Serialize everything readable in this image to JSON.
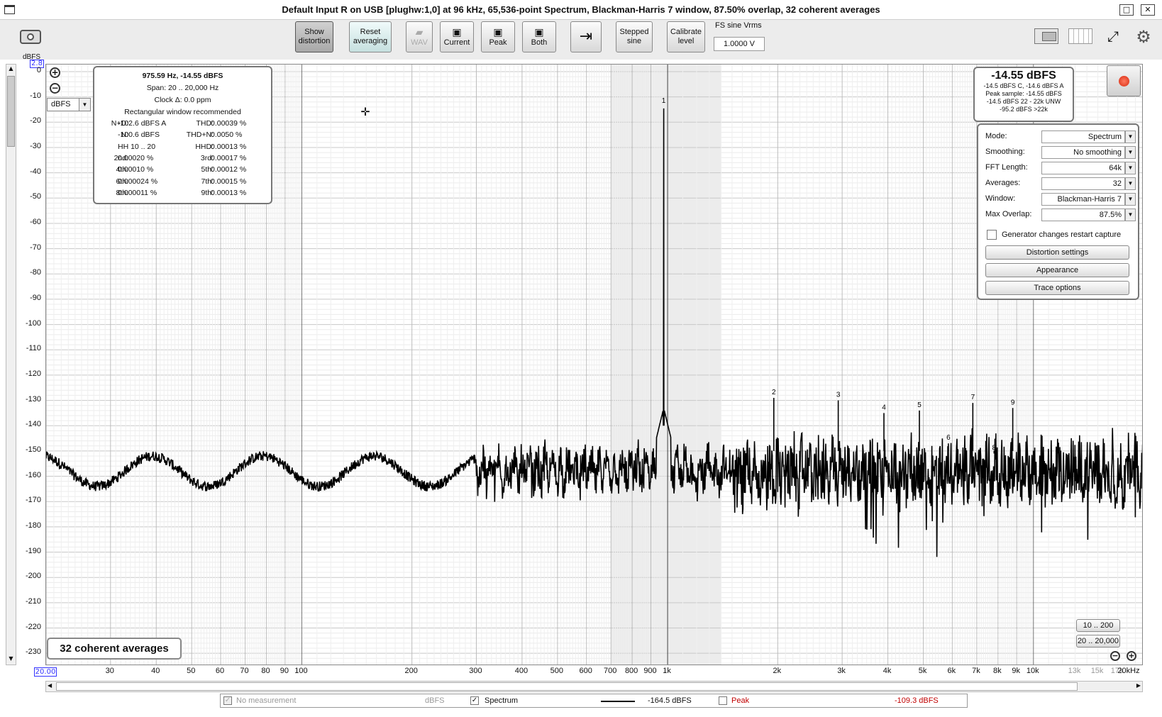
{
  "window": {
    "title": "Default Input R on USB [plughw:1,0] at 96 kHz, 65,536-point Spectrum, Blackman-Harris 7 window, 87.50% overlap, 32 coherent averages",
    "maximize_glyph": "□",
    "close_glyph": "✕"
  },
  "toolbar": {
    "show_distortion": [
      "Show",
      "distortion"
    ],
    "reset_averaging": [
      "Reset",
      "averaging"
    ],
    "wav": "WAV",
    "current": "Current",
    "peak": "Peak",
    "both": "Both",
    "stepped_sine": [
      "Stepped",
      "sine"
    ],
    "calibrate_level": [
      "Calibrate",
      "level"
    ],
    "fs_label": "FS sine Vrms",
    "fs_value": "1.0000 V"
  },
  "graph": {
    "y_unit": "dBFS",
    "y_top_value": "2.8",
    "x_left_value": "20.00",
    "units_select": "dBFS",
    "averages_badge": "32 coherent averages",
    "range_buttons": [
      "10 .. 200",
      "20 .. 20,000"
    ]
  },
  "distortion_panel": {
    "header": "975.59 Hz, -14.55 dBFS",
    "span": "Span: 20 .. 20,000 Hz",
    "clock": "Clock Δ: 0.0 ppm",
    "note": "Rectangular window recommended",
    "rows": [
      [
        "N+D:",
        "-102.6 dBFS A",
        "THD:",
        "0.00039 %"
      ],
      [
        "N:",
        "-100.6 dBFS",
        "THD+N:",
        "0.0050 %"
      ],
      [
        "",
        "HH 10 .. 20",
        "HHD:",
        "0.00013 %"
      ],
      [
        "2nd:",
        "0.00020 %",
        "3rd:",
        "0.00017 %"
      ],
      [
        "4th:",
        "0.00010 %",
        "5th:",
        "0.00012 %"
      ],
      [
        "6th:",
        "0.000024 %",
        "7th:",
        "0.00015 %"
      ],
      [
        "8th:",
        "0.000011 %",
        "9th:",
        "0.00013 %"
      ]
    ]
  },
  "level_panel": {
    "main": "-14.55 dBFS",
    "lines": [
      "-14.5 dBFS C, -14.6 dBFS A",
      "Peak sample: -14.55 dBFS",
      "-14.5 dBFS 22 - 22k UNW",
      "-95.2 dBFS >22k"
    ]
  },
  "settings": {
    "rows": [
      {
        "label": "Mode:",
        "value": "Spectrum"
      },
      {
        "label": "Smoothing:",
        "value": "No  smoothing"
      },
      {
        "label": "FFT Length:",
        "value": "64k"
      },
      {
        "label": "Averages:",
        "value": "32"
      },
      {
        "label": "Window:",
        "value": "Blackman-Harris 7"
      },
      {
        "label": "Max Overlap:",
        "value": "87.5%"
      }
    ],
    "checkbox_label": "Generator changes restart capture",
    "buttons": [
      "Distortion settings",
      "Appearance",
      "Trace options"
    ]
  },
  "legend": {
    "no_measurement": "No measurement",
    "no_measurement_unit": "dBFS",
    "spectrum": "Spectrum",
    "spectrum_value": "-164.5 dBFS",
    "peak": "Peak",
    "peak_value": "-109.3 dBFS",
    "peak_color": "#c00000"
  },
  "chart_data": {
    "type": "line",
    "x_scale": "log",
    "xlim": [
      20,
      20000
    ],
    "ylim": [
      -235,
      2.8
    ],
    "y_ticks": [
      0,
      -10,
      -20,
      -30,
      -40,
      -50,
      -60,
      -70,
      -80,
      -90,
      -100,
      -110,
      -120,
      -130,
      -140,
      -150,
      -160,
      -170,
      -180,
      -190,
      -200,
      -210,
      -220,
      -230
    ],
    "x_ticks": [
      {
        "v": 30,
        "t": "30"
      },
      {
        "v": 40,
        "t": "40"
      },
      {
        "v": 50,
        "t": "50"
      },
      {
        "v": 60,
        "t": "60"
      },
      {
        "v": 70,
        "t": "70"
      },
      {
        "v": 80,
        "t": "80"
      },
      {
        "v": 90,
        "t": "90"
      },
      {
        "v": 100,
        "t": "100"
      },
      {
        "v": 200,
        "t": "200"
      },
      {
        "v": 300,
        "t": "300"
      },
      {
        "v": 400,
        "t": "400"
      },
      {
        "v": 500,
        "t": "500"
      },
      {
        "v": 600,
        "t": "600"
      },
      {
        "v": 700,
        "t": "700"
      },
      {
        "v": 800,
        "t": "800"
      },
      {
        "v": 900,
        "t": "900"
      },
      {
        "v": 1000,
        "t": "1k"
      },
      {
        "v": 2000,
        "t": "2k"
      },
      {
        "v": 3000,
        "t": "3k"
      },
      {
        "v": 4000,
        "t": "4k"
      },
      {
        "v": 5000,
        "t": "5k"
      },
      {
        "v": 6000,
        "t": "6k"
      },
      {
        "v": 7000,
        "t": "7k"
      },
      {
        "v": 8000,
        "t": "8k"
      },
      {
        "v": 9000,
        "t": "9k"
      },
      {
        "v": 10000,
        "t": "10k"
      },
      {
        "v": 13000,
        "t": "13k",
        "dim": true
      },
      {
        "v": 15000,
        "t": "15k",
        "dim": true
      },
      {
        "v": 17000,
        "t": "17k",
        "dim": true
      },
      {
        "v": 20000,
        "t": "20kHz"
      }
    ],
    "shaded_band": [
      700,
      1400
    ],
    "cursor_x": 1000,
    "fundamental": {
      "freq": 975.59,
      "level": -14.55,
      "label": "1"
    },
    "harmonics": [
      {
        "n": "2",
        "freq": 1951,
        "level": -129
      },
      {
        "n": "3",
        "freq": 2927,
        "level": -130
      },
      {
        "n": "4",
        "freq": 3902,
        "level": -135
      },
      {
        "n": "5",
        "freq": 4878,
        "level": -134
      },
      {
        "n": "6",
        "freq": 5854,
        "level": -147
      },
      {
        "n": "7",
        "freq": 6829,
        "level": -131
      },
      {
        "n": "8",
        "freq": 7805,
        "level": -151
      },
      {
        "n": "9",
        "freq": 8780,
        "level": -133
      }
    ],
    "series": [
      {
        "name": "Spectrum",
        "color": "#000000"
      }
    ],
    "noise_floor_db": -158,
    "grid": true
  }
}
